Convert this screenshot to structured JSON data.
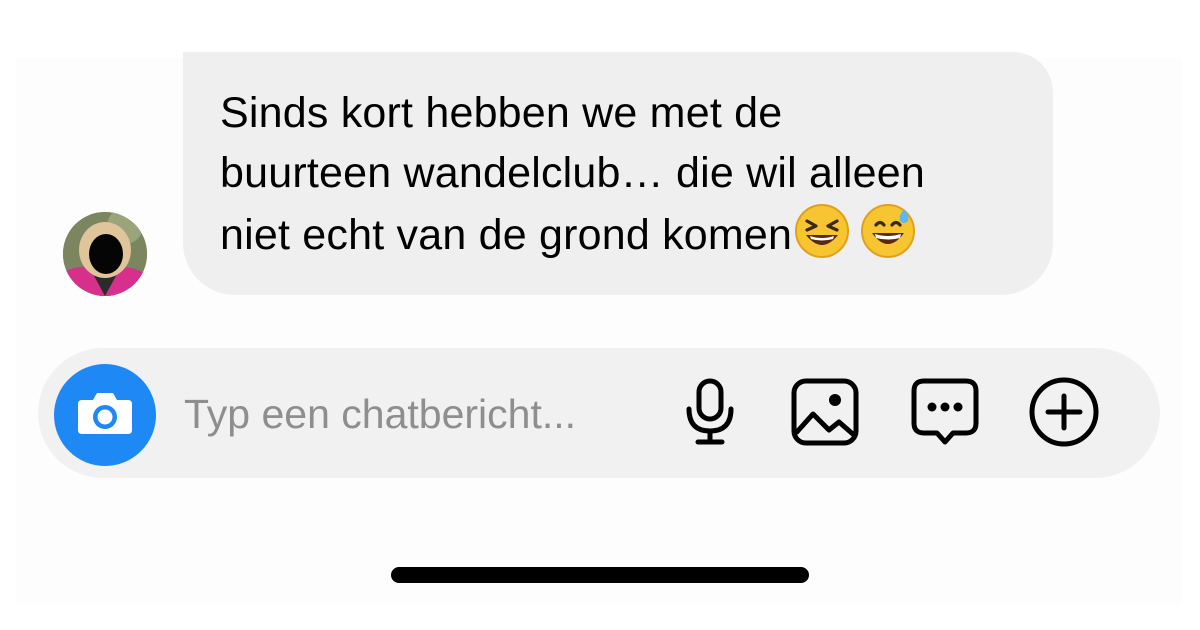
{
  "message": {
    "lines": [
      "Sinds kort hebben we met de",
      "buurteen wandelclub… die wil alleen",
      "niet echt van de grond komen"
    ],
    "emojis": [
      "laughing-face-emoji",
      "sweat-smile-face-emoji"
    ]
  },
  "composer": {
    "placeholder": "Typ een chatbericht...",
    "buttons": [
      "camera-icon",
      "microphone-icon",
      "image-icon",
      "chat-bubble-icon",
      "plus-circle-icon"
    ]
  },
  "colors": {
    "camera_button": "#1e88f5",
    "bubble": "#efefef",
    "composer": "#f1f1f1",
    "placeholder_text": "#8e8e8e"
  }
}
